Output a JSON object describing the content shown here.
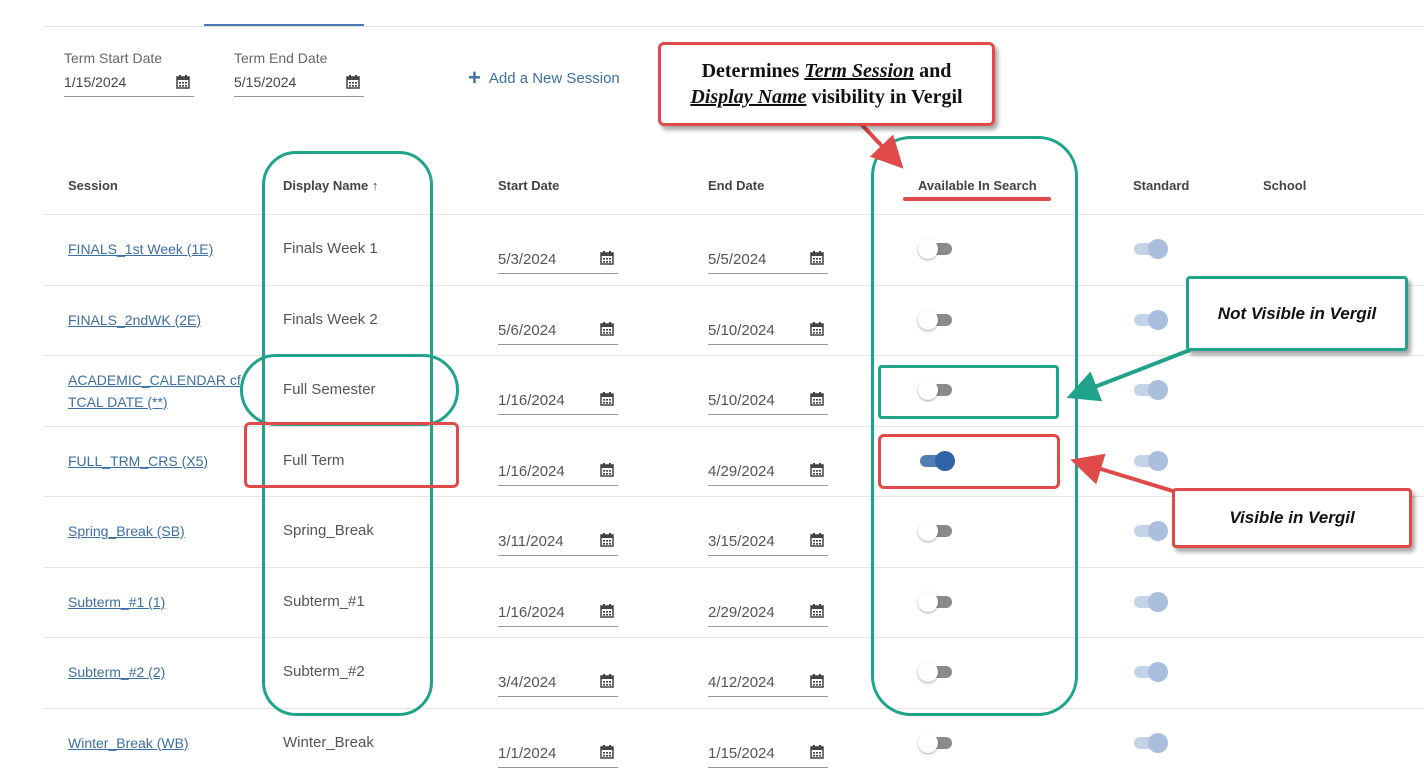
{
  "term": {
    "start_label": "Term Start Date",
    "start_value": "1/15/2024",
    "end_label": "Term End Date",
    "end_value": "5/15/2024"
  },
  "actions": {
    "add_session": "Add a New Session"
  },
  "columns": {
    "session": "Session",
    "display_name": "Display Name",
    "sort_arrow": "↑",
    "start_date": "Start Date",
    "end_date": "End Date",
    "available": "Available In Search",
    "standard": "Standard",
    "school": "School"
  },
  "rows": [
    {
      "session": "FINALS_1st Week (1E)",
      "display": "Finals Week 1",
      "start": "5/3/2024",
      "end": "5/5/2024",
      "available": false,
      "standard": true
    },
    {
      "session": "FINALS_2ndWK (2E)",
      "display": "Finals Week 2",
      "start": "5/6/2024",
      "end": "5/10/2024",
      "available": false,
      "standard": true
    },
    {
      "session": "ACADEMIC_CALENDAR cf",
      "session2": "TCAL DATE (**)",
      "display": "Full Semester",
      "start": "1/16/2024",
      "end": "5/10/2024",
      "available": false,
      "standard": true
    },
    {
      "session": "FULL_TRM_CRS (X5)",
      "display": "Full Term",
      "start": "1/16/2024",
      "end": "4/29/2024",
      "available": true,
      "standard": true
    },
    {
      "session": "Spring_Break (SB)",
      "display": "Spring_Break",
      "start": "3/11/2024",
      "end": "3/15/2024",
      "available": false,
      "standard": true
    },
    {
      "session": "Subterm_#1 (1)",
      "display": "Subterm_#1",
      "start": "1/16/2024",
      "end": "2/29/2024",
      "available": false,
      "standard": true
    },
    {
      "session": "Subterm_#2 (2)",
      "display": "Subterm_#2",
      "start": "3/4/2024",
      "end": "4/12/2024",
      "available": false,
      "standard": true
    },
    {
      "session": "Winter_Break (WB)",
      "display": "Winter_Break",
      "start": "1/1/2024",
      "end": "1/15/2024",
      "available": false,
      "standard": true
    }
  ],
  "annotations": {
    "determines_1": "Determines",
    "term_session": "Term Session",
    "and": "and",
    "display_name": "Display Name",
    "visibility": "visibility in Vergil",
    "not_visible": "Not Visible in Vergil",
    "visible": "Visible in Vergil"
  },
  "colors": {
    "link": "#3d6fa3",
    "green": "#1fa38a",
    "red": "#e04a4a",
    "toggle_on": "#2f64a8"
  }
}
